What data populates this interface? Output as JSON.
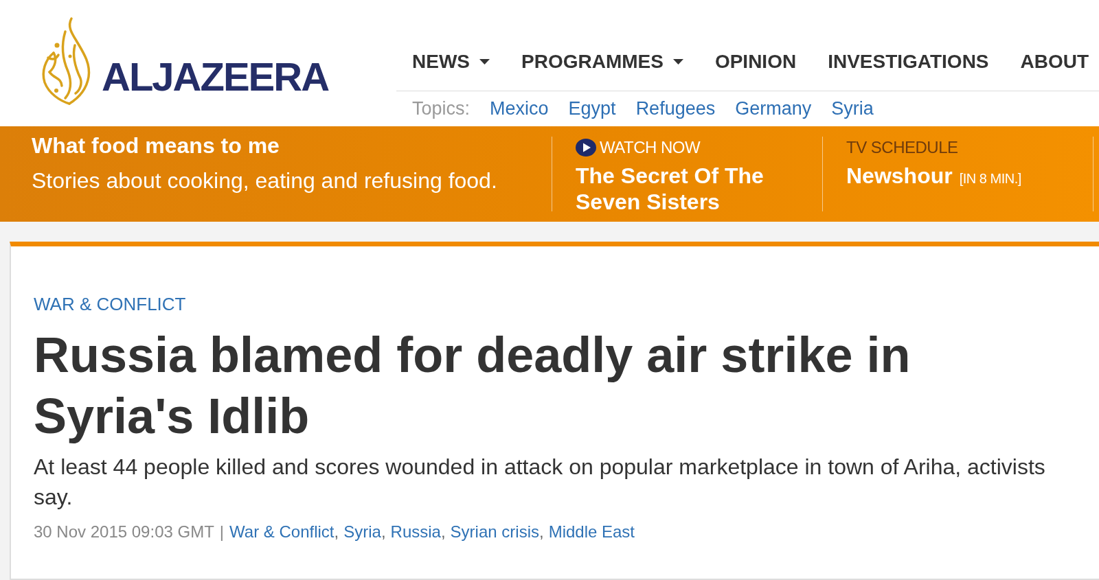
{
  "logo": {
    "wordmark": "ALJAZEERA"
  },
  "nav": {
    "items": [
      {
        "label": "NEWS",
        "dropdown": true
      },
      {
        "label": "PROGRAMMES",
        "dropdown": true
      },
      {
        "label": "OPINION",
        "dropdown": false
      },
      {
        "label": "INVESTIGATIONS",
        "dropdown": false
      },
      {
        "label": "ABOUT",
        "dropdown": false
      }
    ]
  },
  "topics": {
    "label": "Topics:",
    "items": [
      "Mexico",
      "Egypt",
      "Refugees",
      "Germany",
      "Syria"
    ]
  },
  "banner": {
    "feature": {
      "title": "What food means to me",
      "subtitle": "Stories about cooking, eating and refusing food."
    },
    "watch": {
      "label": "WATCH NOW",
      "title": "The Secret Of The Seven Sisters"
    },
    "schedule": {
      "label": "TV SCHEDULE",
      "title": "Newshour",
      "note": "[IN 8 MIN.]"
    }
  },
  "article": {
    "section": "WAR & CONFLICT",
    "headline": "Russia blamed for deadly air strike in Syria's Idlib",
    "summary": "At least 44 people killed and scores wounded in attack on popular marketplace in town of Ariha, activists say.",
    "meta": {
      "timestamp": "30 Nov 2015 09:03 GMT",
      "divider": "|",
      "tag_separator": ",",
      "tags": [
        "War & Conflict",
        "Syria",
        "Russia",
        "Syrian crisis",
        "Middle East"
      ]
    }
  }
}
